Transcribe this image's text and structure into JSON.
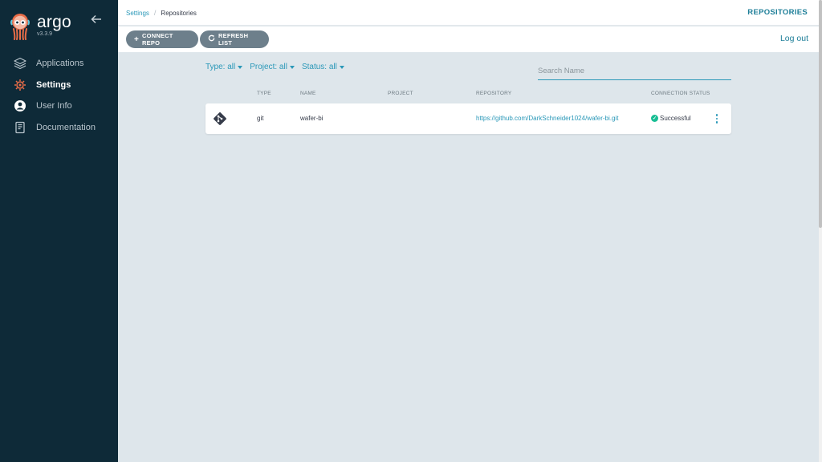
{
  "app": {
    "name": "argo",
    "version": "v3.3.9"
  },
  "sidebar": {
    "items": [
      {
        "label": "Applications",
        "icon": "layers-icon"
      },
      {
        "label": "Settings",
        "icon": "gears-icon"
      },
      {
        "label": "User Info",
        "icon": "user-circle-icon"
      },
      {
        "label": "Documentation",
        "icon": "book-icon"
      }
    ],
    "active": "Settings"
  },
  "topbar": {
    "breadcrumbs": [
      "Settings",
      "Repositories"
    ],
    "title": "REPOSITORIES"
  },
  "toolbar": {
    "connect_label": "CONNECT REPO",
    "refresh_label": "REFRESH LIST",
    "logout_label": "Log out"
  },
  "filters": {
    "type": "Type: all",
    "project": "Project: all",
    "status": "Status: all"
  },
  "search": {
    "placeholder": "Search Name",
    "value": ""
  },
  "table": {
    "columns": [
      "TYPE",
      "NAME",
      "PROJECT",
      "REPOSITORY",
      "CONNECTION STATUS"
    ],
    "rows": [
      {
        "type": "git",
        "name": "wafer-bi",
        "project": "",
        "repository": "https://github.com/DarkSchneider1024/wafer-bi.git",
        "status": "Successful"
      }
    ]
  },
  "colors": {
    "sidebar_bg": "#0e2a38",
    "accent": "#2a98b8",
    "button_bg": "#6d7f8b",
    "success": "#18be94",
    "page_bg": "#dee6eb"
  }
}
